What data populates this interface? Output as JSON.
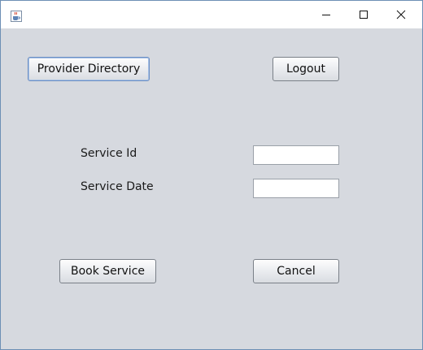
{
  "window": {
    "icon": "java-cup-icon",
    "controls": {
      "minimize": "minimize-icon",
      "maximize": "maximize-icon",
      "close": "close-icon"
    }
  },
  "toolbar": {
    "provider_directory_label": "Provider Directory",
    "logout_label": "Logout"
  },
  "form": {
    "service_id_label": "Service Id",
    "service_id_value": "",
    "service_date_label": "Service Date",
    "service_date_value": ""
  },
  "actions": {
    "book_service_label": "Book Service",
    "cancel_label": "Cancel"
  },
  "colors": {
    "background": "#d6d9df",
    "focus_border": "#6b8fc4"
  }
}
